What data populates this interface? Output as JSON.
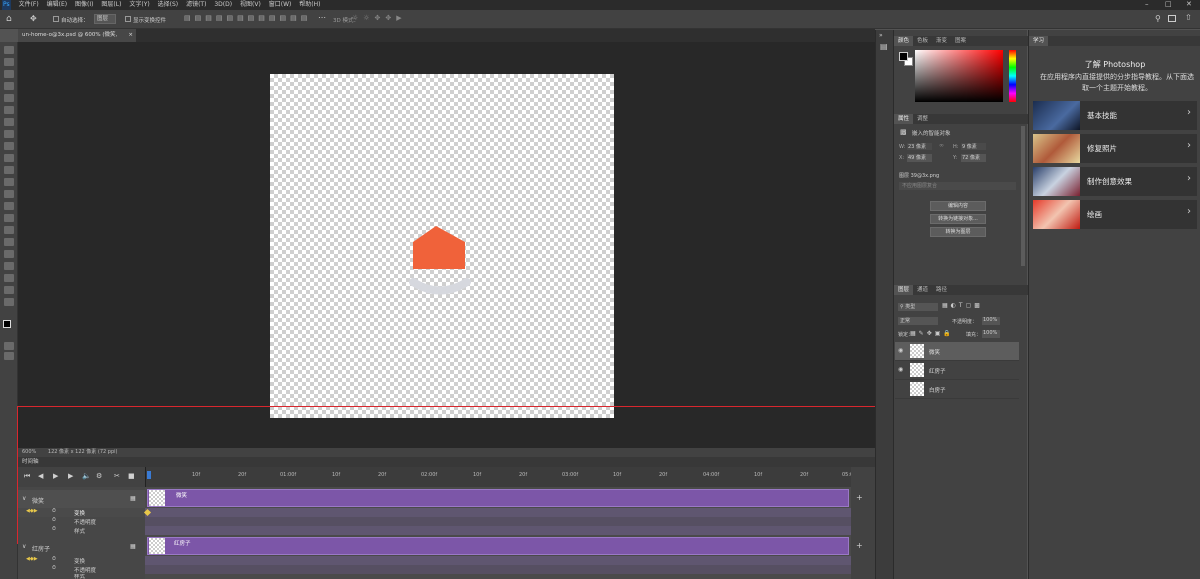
{
  "menu": [
    "Ps",
    "文件(F)",
    "编辑(E)",
    "图像(I)",
    "图层(L)",
    "文字(Y)",
    "选择(S)",
    "滤镜(T)",
    "3D(D)",
    "视图(V)",
    "窗口(W)",
    "帮助(H)"
  ],
  "options": {
    "auto_select": "自动选择：",
    "layer_select": "图层",
    "show_transform": "显示变换控件",
    "mode_3d": "3D 模式："
  },
  "doc_tab": "un-home-o@3x.psd @ 600% (微笑, RGB/8)",
  "status": {
    "zoom": "600%",
    "size": "122 像素 x 122 像素 (72 ppi)"
  },
  "timeline": {
    "title": "时间轴",
    "ticks": [
      "10f",
      "20f",
      "01:00f",
      "10f",
      "20f",
      "02:00f",
      "10f",
      "20f",
      "03:00f",
      "10f",
      "20f",
      "04:00f",
      "10f",
      "20f",
      "05:0"
    ],
    "layers": [
      {
        "name": "微笑",
        "subs": [
          "变换",
          "不透明度",
          "样式"
        ]
      },
      {
        "name": "红房子",
        "subs": [
          "变换",
          "不透明度",
          "样式"
        ]
      }
    ],
    "clips": [
      "微笑",
      "红房子"
    ]
  },
  "color_panel": {
    "tabs": [
      "颜色",
      "色板",
      "渐变",
      "图案"
    ]
  },
  "props_panel": {
    "tabs": [
      "属性",
      "调整"
    ],
    "kind": "嵌入的智能对象",
    "w_label": "W:",
    "w": "23 像素",
    "h_label": "H:",
    "h": "9 像素",
    "x_label": "X:",
    "x": "49 像素",
    "y_label": "Y:",
    "y": "72 像素",
    "source": "图层 39@3x.png",
    "comp": "不应用图层复合",
    "buttons": [
      "编辑内容",
      "转换为链接对象...",
      "转换为图层"
    ]
  },
  "layers_panel": {
    "tabs": [
      "图层",
      "通道",
      "路径"
    ],
    "kind": "类型",
    "blend": "正常",
    "opacity_label": "不透明度：",
    "opacity": "100%",
    "lock_label": "锁定：",
    "fill_label": "填充：",
    "fill": "100%",
    "layers": [
      "微笑",
      "红房子",
      "白房子"
    ]
  },
  "learn": {
    "tab": "学习",
    "title": "了解 Photoshop",
    "desc": "在应用程序内直接提供的分步指导教程。从下面选取一个主题开始教程。",
    "cards": [
      "基本技能",
      "修复照片",
      "制作创意效果",
      "绘画"
    ]
  },
  "colors": {
    "accent": "#f0623a",
    "clip": "#7c56a8",
    "highlight": "#d9272e"
  }
}
